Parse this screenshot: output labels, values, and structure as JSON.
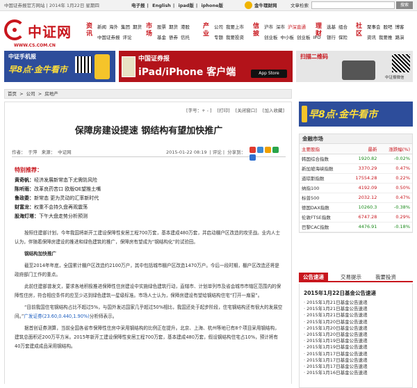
{
  "topbar": {
    "left": "中国证券报官方网站 | 2014年 1月22日 星期四",
    "links": [
      "电子报",
      "English",
      "ipad版",
      "iphone版"
    ],
    "jinniu": "金牛理财网",
    "search_label": "文章检索",
    "search_button": "搜索"
  },
  "logo": {
    "name": "中证网",
    "url": "WWW.CS.COM.CN"
  },
  "nav": [
    {
      "cat": "资讯",
      "rows": [
        [
          "新闻",
          "海外",
          "集团",
          "期货"
        ],
        [
          "中国证券报",
          "评论"
        ]
      ]
    },
    {
      "cat": "市场",
      "rows": [
        [
          "股票",
          "期货",
          "港股"
        ],
        [
          "基金",
          "债券",
          "信托"
        ]
      ]
    },
    {
      "cat": "产业",
      "rows": [
        [
          "公司",
          "我要上市"
        ],
        [
          "专题",
          "我要投资"
        ]
      ]
    },
    {
      "cat": "信披",
      "rows": [
        [
          "沪市",
          "深市",
          "沪深直通"
        ],
        [
          "创业板",
          "中小板",
          "创业板",
          "IPO"
        ]
      ]
    },
    {
      "cat": "理财",
      "rows": [
        [
          "选基",
          "组合"
        ],
        [
          "银行",
          "保险"
        ]
      ]
    },
    {
      "cat": "社区",
      "rows": [
        [
          "聚事会",
          "股吧",
          "博客"
        ],
        [
          "资讯",
          "我要推",
          "路演"
        ]
      ]
    }
  ],
  "ads": {
    "a1_title": "中证手机报",
    "a1_slogan": "早8点·金牛看市",
    "a2_line1": "中国证券报",
    "a2_line2": "iPad/iPhone 客户端",
    "a2_store": "App Store",
    "a3_title": "扫描二维码",
    "a3_label": "中证报微信"
  },
  "breadcrumb": [
    "首页",
    ">",
    "公司",
    ">",
    "房地产"
  ],
  "article": {
    "tools": {
      "font": "[字号：+ - ]",
      "print": "[打印]",
      "close": "[关闭窗口]",
      "fav": "[加入收藏]"
    },
    "title": "保障房建设提速 钢结构有望加快推广",
    "author_label": "作者：",
    "author": "于萍",
    "source_label": "来源：",
    "source": "中证网",
    "datetime": "2015-01-22 08:19",
    "comment": "| 评论 |",
    "share": "分享到：",
    "rec_heading": "特别推荐：",
    "rec": [
      {
        "k": "黄奇帆：",
        "v": "经济发展新常态下尤需防风险"
      },
      {
        "k": "陈听雨：",
        "v": "改革良药苦口 欧版QE望推土嘴"
      },
      {
        "k": "鲁政委：",
        "v": "新常态 更为灵动的汇率新时代"
      },
      {
        "k": "财富龙：",
        "v": "权重不会持久盘再观震荡"
      },
      {
        "k": "股海灯塔：",
        "v": "下午大盘走势分析预测"
      }
    ],
    "p1": "按照住建部计划，今年我国将新开工建设保障性安居工程700万套，基本建成480万套，并启动棚户区改造的攻坚战。业内人士认为，伴随着保障房建设的推进和绿色建筑的推广，保障房有望成为“钢结构化”的试验田。",
    "sub1": "钢结构加快推广",
    "p2": "截至2014年年底，全国累计棚户区改造约2100万户，其中包括城市棚户区改造1470万户。今后一段时期，棚户区改造还将是政府部门工作的重点。",
    "p3": "此前住建部曾发文，要求各地积极推进保障性住房建设中实施绿色建筑行动，直辖市、计划单列市及省会城市市辖区范围内的保障性住房，符合相应条件的应至少达到绿色建筑一星级标准。市场人士认为，保障房建设有望给钢结构住宅“打开一扇窗”。",
    "p4a": "“目前我国住宅钢结构占比不超过5%，与国外发达国家几乎超过50%相比，我国还处于起步阶段，住宅钢结构还有很大的发展空间。”",
    "p4link": "广发证券",
    "p4code": "(23.60,0.440,1.90%)",
    "p4b": "分析师表示。",
    "p5": "据首创证券测算，当前全国各省市保障性住房中采用钢结构的比例正在提升。北京、上海、杭州等地已有8个项目采用钢结构，建筑总面积近200万平方米。2015年新开工建设保障性安居工程700万套，基本建成480万套，假设钢结构住宅占10%，预计将有40万套建成成品采用钢结构。"
  },
  "side_ad": {
    "slogan": "早8点·金牛看市"
  },
  "market": {
    "title": "金融市场",
    "headers": [
      "主要股指",
      "最新",
      "涨跌幅(%)"
    ],
    "rows": [
      {
        "name": "韩国综合指数",
        "last": "1920.82",
        "chg": "-0.02%",
        "dir": "down"
      },
      {
        "name": "新加坡海峡指数",
        "last": "3370.29",
        "chg": "0.47%",
        "dir": "up"
      },
      {
        "name": "道琼斯指数",
        "last": "17554.28",
        "chg": "0.22%",
        "dir": "up"
      },
      {
        "name": "纳指100",
        "last": "4192.09",
        "chg": "0.50%",
        "dir": "up"
      },
      {
        "name": "标普500",
        "last": "2032.12",
        "chg": "0.47%",
        "dir": "up"
      },
      {
        "name": "德国DAX指数",
        "last": "10260.3",
        "chg": "-0.38%",
        "dir": "down"
      },
      {
        "name": "伦敦FTSE指数",
        "last": "6747.28",
        "chg": "0.29%",
        "dir": "up"
      },
      {
        "name": "巴黎CAC指数",
        "last": "4476.91",
        "chg": "-0.18%",
        "dir": "down"
      }
    ]
  },
  "tabs": [
    "公告速递",
    "交易提示",
    "我要投资"
  ],
  "news": {
    "title": "2015年1月22日基金公告速递",
    "items": [
      "· 2015年1月21日基金公告速递",
      "· 2015年1月21日基金公告速递",
      "· 2015年1月21日基金公告速递",
      "· 2015年1月20日基金公告速递",
      "· 2015年1月20日基金公告速递",
      "· 2015年1月20日基金公告速递",
      "· 2015年1月19日基金公告速递",
      "· 2015年1月19日基金公告速递",
      "· 2015年1月17日基金公告速递",
      "· 2015年1月17日基金公告速递",
      "· 2015年1月17日基金公告速递",
      "· 2015年1月16日基金公告速递"
    ]
  }
}
